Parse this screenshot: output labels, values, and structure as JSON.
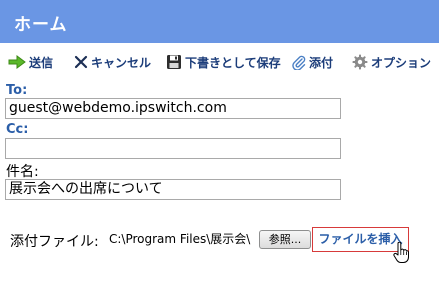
{
  "header": {
    "title": "ホーム"
  },
  "toolbar": {
    "send": "送信",
    "cancel": "キャンセル",
    "save_draft": "下書きとして保存",
    "attach": "添付",
    "options": "オプション"
  },
  "to": {
    "label": "To:",
    "value": "guest@webdemo.ipswitch.com"
  },
  "cc": {
    "label": "Cc:",
    "value": ""
  },
  "subject": {
    "label": "件名:",
    "value": "展示会への出席について"
  },
  "attachment": {
    "label": "添付ファイル:",
    "file_path": "C:\\Program Files\\展示会\\",
    "browse_label": "参照...",
    "insert_label": "ファイルを挿入"
  },
  "colors": {
    "header_bg": "#6a96e4",
    "label_blue": "#2b5ea8",
    "insert_border": "#d73a3a"
  },
  "icons": [
    "send-arrow-icon",
    "cancel-x-icon",
    "save-disk-icon",
    "paperclip-icon",
    "gear-icon",
    "hand-cursor-icon"
  ]
}
